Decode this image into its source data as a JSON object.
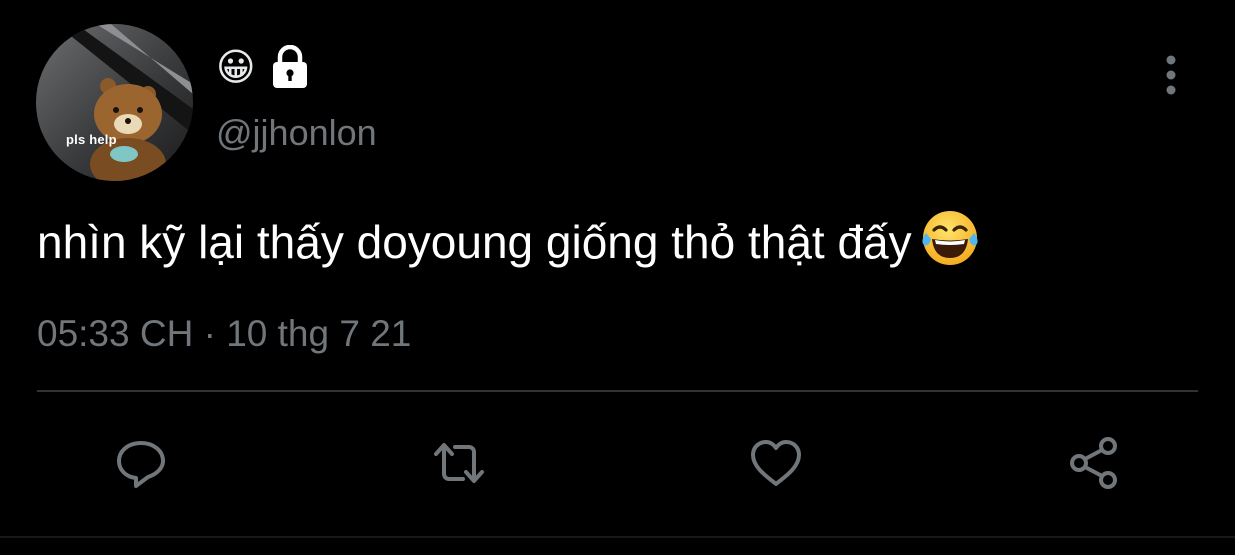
{
  "tweet": {
    "avatar": {
      "caption": "pls help",
      "icon": "bear-plush-avatar"
    },
    "author": {
      "display_name": "😀",
      "protected_icon": "lock-icon",
      "handle": "@jjhonlon"
    },
    "more_icon": "more-vertical-icon",
    "text": "nhìn kỹ lại thấy doyoung giống thỏ thật đấy",
    "text_emoji": "laughing-tears-emoji",
    "timestamp": "05:33 CH · 10 thg 7 21"
  },
  "actions": [
    {
      "name": "reply",
      "icon": "reply-icon"
    },
    {
      "name": "retweet",
      "icon": "retweet-icon"
    },
    {
      "name": "like",
      "icon": "heart-icon"
    },
    {
      "name": "share",
      "icon": "share-icon"
    }
  ],
  "colors": {
    "background": "#000000",
    "primary_text": "#ffffff",
    "secondary_text": "#71767b",
    "divider": "#2f3336"
  }
}
